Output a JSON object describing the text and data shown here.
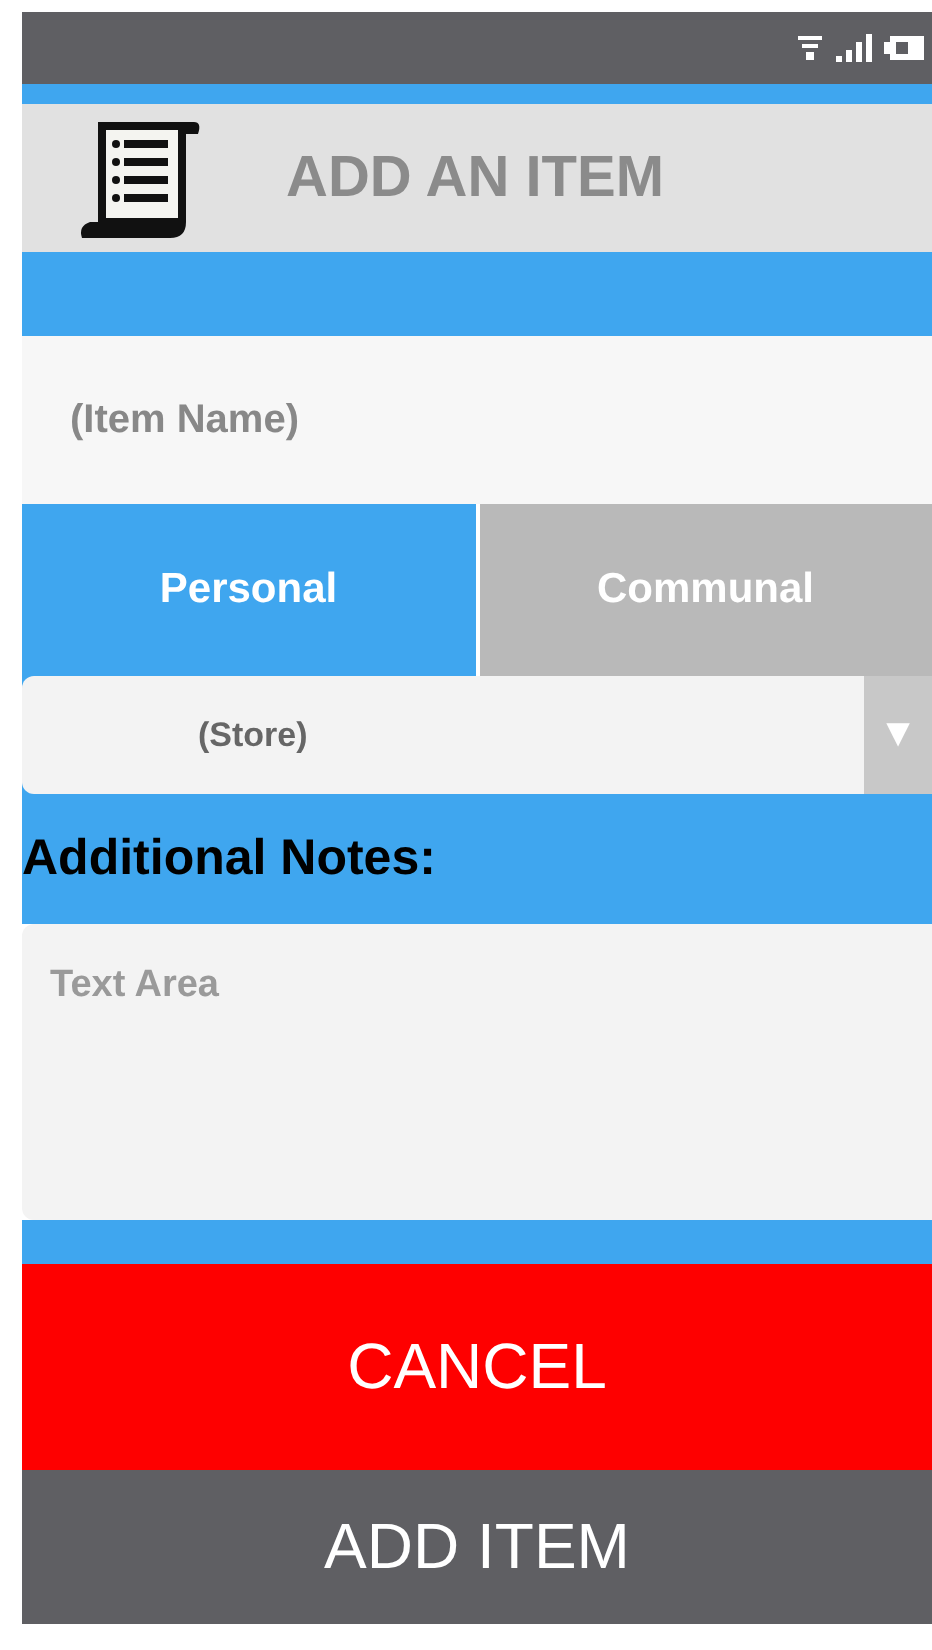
{
  "header": {
    "title": "ADD AN ITEM"
  },
  "item_name": {
    "placeholder": "(Item Name)"
  },
  "tabs": [
    {
      "label": "Personal",
      "selected": true
    },
    {
      "label": "Communal",
      "selected": false
    }
  ],
  "store_select": {
    "placeholder": "(Store)",
    "arrow": "▼"
  },
  "notes": {
    "label": "Additional Notes:",
    "placeholder": "Text Area"
  },
  "buttons": [
    {
      "label": "CANCEL",
      "kind": "danger"
    },
    {
      "label": "ADD ITEM",
      "kind": "primary"
    }
  ]
}
